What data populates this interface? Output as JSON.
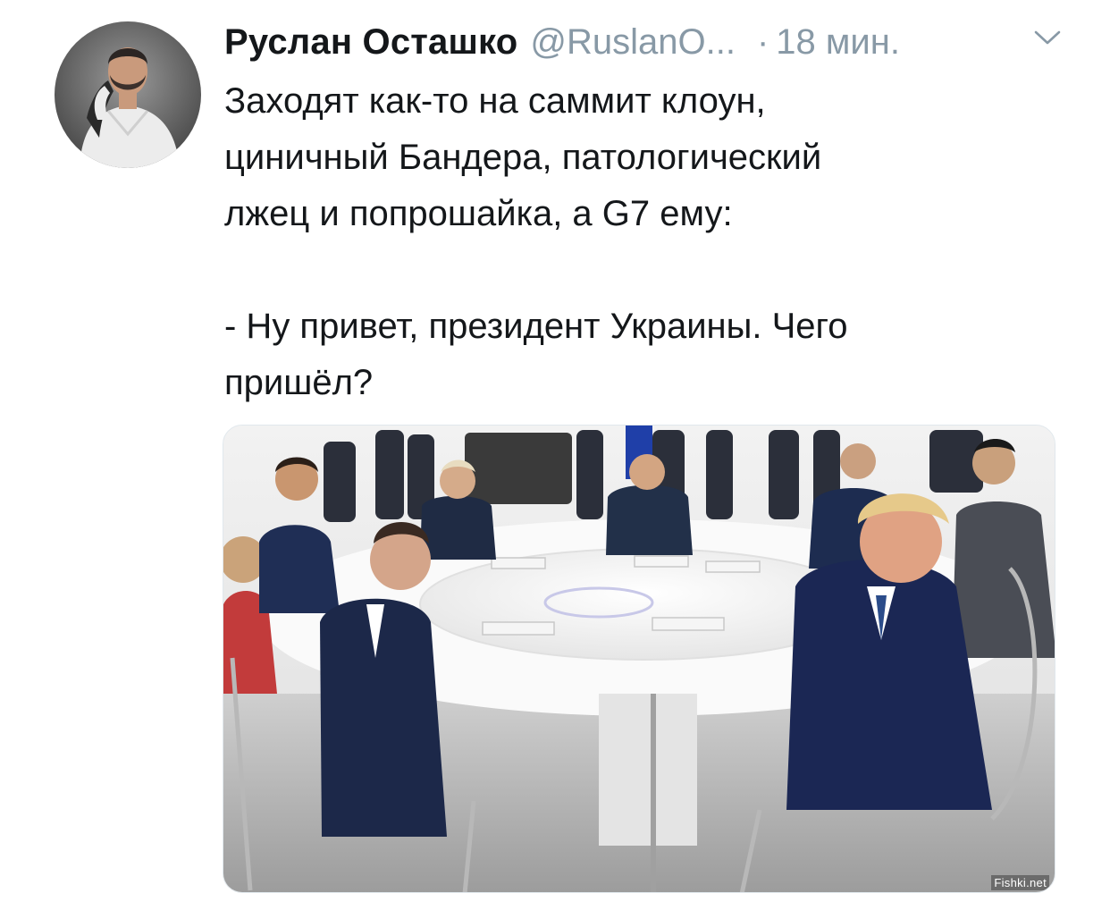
{
  "tweet": {
    "author_name": "Руслан Осташко",
    "handle": "@RuslanO...",
    "separator": "·",
    "time": "18 мин.",
    "text": "Заходят как-то на саммит клоун,\nциничный Бандера, патологический\nлжец и попрошайка, а G7 ему:\n\n- Ну привет, президент Украины. Чего\nпришёл?",
    "menu_icon": "chevron-down-icon",
    "media_alt": "G7 summit round table photo"
  },
  "watermark": "Fishki.net",
  "colors": {
    "text": "#14171a",
    "muted": "#8899a6",
    "border": "#e1e8ed"
  }
}
